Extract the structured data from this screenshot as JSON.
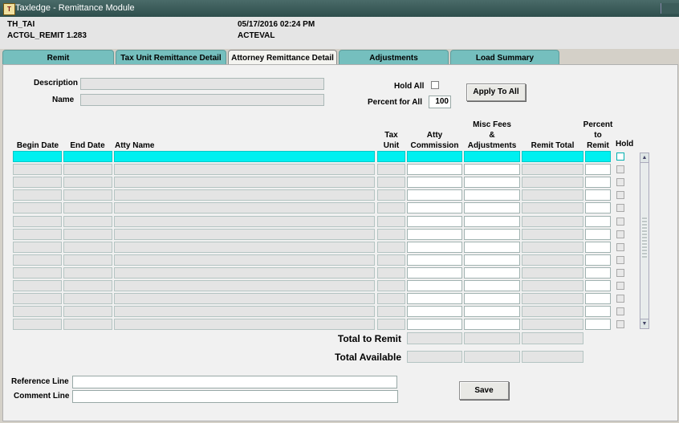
{
  "window": {
    "title": "Taxledge - Remittance Module"
  },
  "header": {
    "user": "TH_TAI",
    "form_id": "ACTGL_REMIT 1.283",
    "datetime": "05/17/2016 02:24 PM",
    "env": "ACTEVAL"
  },
  "tabs": [
    {
      "label": "Remit"
    },
    {
      "label": "Tax Unit Remittance Detail"
    },
    {
      "label": "Attorney Remittance Detail",
      "active": true
    },
    {
      "label": "Adjustments"
    },
    {
      "label": "Load Summary"
    }
  ],
  "form": {
    "description_label": "Description",
    "name_label": "Name",
    "hold_all_label": "Hold All",
    "percent_for_all_label": "Percent for All",
    "percent_for_all_value": "100",
    "apply_to_all_label": "Apply To All"
  },
  "table": {
    "columns": {
      "begin_date": "Begin Date",
      "end_date": "End Date",
      "atty_name": "Atty Name",
      "tax_unit_1": "Tax",
      "tax_unit_2": "Unit",
      "atty_commission_1": "Atty",
      "atty_commission_2": "Commission",
      "misc_fees_1": "Misc Fees",
      "misc_fees_2": "&",
      "misc_fees_3": "Adjustments",
      "remit_total": "Remit Total",
      "percent_1": "Percent",
      "percent_2": "to",
      "percent_3": "Remit",
      "hold": "Hold"
    },
    "row_count": 14
  },
  "totals": {
    "total_to_remit_label": "Total to Remit",
    "total_available_label": "Total Available"
  },
  "footer": {
    "reference_line_label": "Reference Line",
    "comment_line_label": "Comment Line",
    "save_label": "Save"
  },
  "colors": {
    "title_bar": "#2e4e4c",
    "tab": "#75bfbe",
    "row_highlight": "#00f0f0"
  }
}
